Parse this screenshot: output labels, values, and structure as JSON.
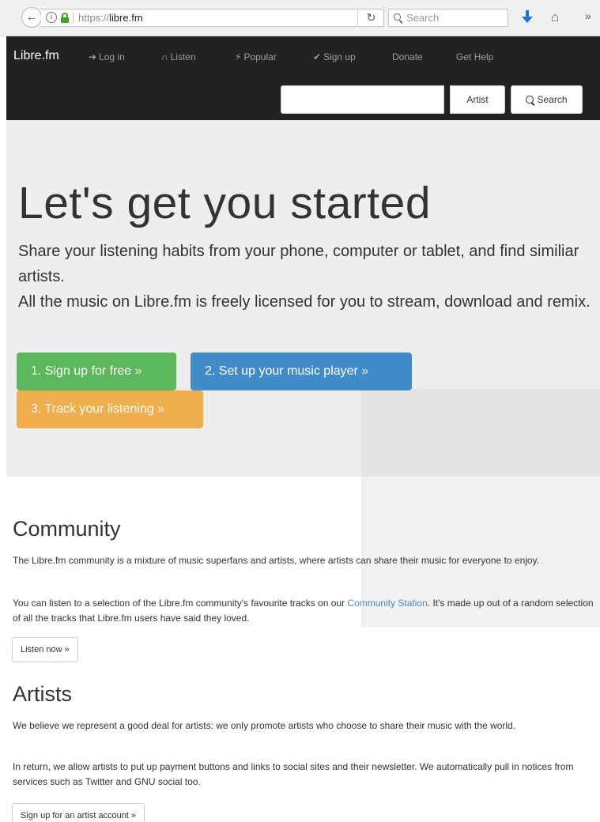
{
  "browser": {
    "back_icon": "back-arrow-icon",
    "url_prefix": "https://",
    "url_host": "libre.fm",
    "reload_glyph": "C",
    "search_placeholder": "Search",
    "overflow_glyph": "»"
  },
  "nav": {
    "brand": "Libre.fm",
    "items": [
      {
        "label": "Log in",
        "icon": "login-icon"
      },
      {
        "label": "Listen",
        "icon": "headphones-icon"
      },
      {
        "label": "Popular",
        "icon": "flash-icon"
      },
      {
        "label": "Sign up",
        "icon": "check-icon"
      },
      {
        "label": "Donate"
      },
      {
        "label": "Get Help"
      }
    ],
    "search_value": "",
    "artist_label": "Artist",
    "search_label": "Search",
    "bg_color": "#222222"
  },
  "hero": {
    "title": "Let's get you started",
    "line1": "Share your listening habits from your phone, computer or tablet, and find similiar artists.",
    "line2": "All the music on Libre.fm is freely licensed for you to stream, download and remix.",
    "buttons": [
      {
        "label": "1. Sign up for free",
        "color": "#5cb85c"
      },
      {
        "label": "2. Set up your music player",
        "color": "#428bca"
      },
      {
        "label": "3. Track your listening",
        "color": "#f0ad4e"
      }
    ],
    "raquo": "»"
  },
  "community": {
    "title": "Community",
    "p1": "The Libre.fm community is a mixture of music superfans and artists, where artists can share their music for everyone to enjoy.",
    "p2_before": "You can listen to a selection of the Libre.fm community's favourite tracks on our ",
    "p2_link": "Community Station",
    "p2_after": ". It's made up out of a random selection of all the tracks that Libre.fm users have said they loved.",
    "button": "Listen now »"
  },
  "artists": {
    "title": "Artists",
    "p1": "We believe we represent a good deal for artists: we only promote artists who choose to share their music with the world.",
    "p2": "In return, we allow artists to put up payment buttons and links to social sites and their newsletter. We automatically pull in notices from services such as Twitter and GNU social too.",
    "button": "Sign up for an artist account »"
  }
}
